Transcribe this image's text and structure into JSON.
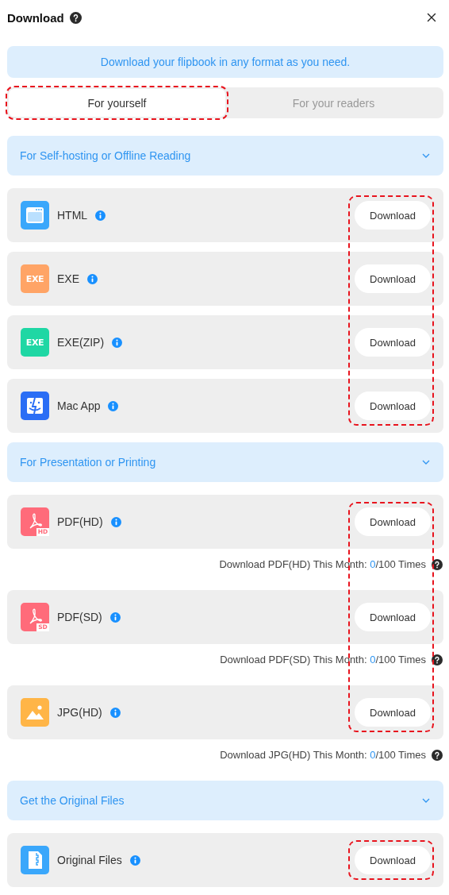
{
  "dialog": {
    "title": "Download"
  },
  "banner": "Download your flipbook in any format as you need.",
  "tabs": [
    {
      "label": "For yourself",
      "selected": true,
      "highlighted": true
    },
    {
      "label": "For your readers",
      "selected": false,
      "highlighted": false
    }
  ],
  "sections": [
    {
      "title": "For Self-hosting or Offline Reading",
      "expanded": true,
      "highlighted": true,
      "items": [
        {
          "name": "HTML",
          "button": "Download",
          "icon": {
            "kind": "window",
            "color": "#3aa7fb"
          }
        },
        {
          "name": "EXE",
          "button": "Download",
          "icon": {
            "kind": "badge",
            "color": "#ffa466",
            "badge": "EXE"
          }
        },
        {
          "name": "EXE(ZIP)",
          "button": "Download",
          "icon": {
            "kind": "badge",
            "color": "#1fd7a4",
            "badge": "EXE"
          }
        },
        {
          "name": "Mac App",
          "button": "Download",
          "icon": {
            "kind": "finder",
            "color": "#2b6ef5"
          }
        }
      ]
    },
    {
      "title": "For Presentation or Printing",
      "expanded": true,
      "highlighted": true,
      "items": [
        {
          "name": "PDF(HD)",
          "button": "Download",
          "icon": {
            "kind": "pdf",
            "color": "#ff6b7a",
            "badge": "HD"
          },
          "usage": {
            "label": "Download PDF(HD) This Month: ",
            "used": "0",
            "limit": "/100 Times"
          }
        },
        {
          "name": "PDF(SD)",
          "button": "Download",
          "icon": {
            "kind": "pdf",
            "color": "#ff6b7a",
            "badge": "SD"
          },
          "usage": {
            "label": "Download PDF(SD) This Month: ",
            "used": "0",
            "limit": "/100 Times"
          }
        },
        {
          "name": "JPG(HD)",
          "button": "Download",
          "icon": {
            "kind": "image",
            "color": "#ffb547"
          },
          "usage": {
            "label": "Download JPG(HD) This Month: ",
            "used": "0",
            "limit": "/100 Times"
          }
        }
      ]
    },
    {
      "title": "Get the Original Files",
      "expanded": true,
      "highlighted": true,
      "items": [
        {
          "name": "Original Files",
          "button": "Download",
          "icon": {
            "kind": "zip",
            "color": "#3aa7fb"
          }
        }
      ]
    }
  ]
}
